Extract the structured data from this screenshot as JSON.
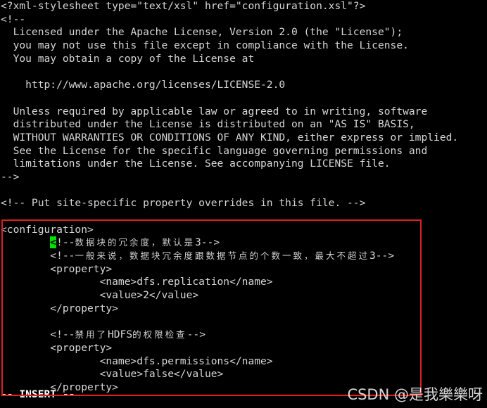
{
  "terminal": {
    "app": "vim",
    "mode_status": "-- INSERT --",
    "background_color": "#000000",
    "foreground_color": "#d4d4d4",
    "cursor_color": "#00e000",
    "cursor_char": "<",
    "lines": [
      {
        "id": "l01",
        "text": "<?xml-stylesheet type=\"text/xsl\" href=\"configuration.xsl\"?>"
      },
      {
        "id": "l02",
        "text": "<!--"
      },
      {
        "id": "l03",
        "text": "  Licensed under the Apache License, Version 2.0 (the \"License\");"
      },
      {
        "id": "l04",
        "text": "  you may not use this file except in compliance with the License."
      },
      {
        "id": "l05",
        "text": "  You may obtain a copy of the License at"
      },
      {
        "id": "l06",
        "text": ""
      },
      {
        "id": "l07",
        "text": "    http://www.apache.org/licenses/LICENSE-2.0"
      },
      {
        "id": "l08",
        "text": ""
      },
      {
        "id": "l09",
        "text": "  Unless required by applicable law or agreed to in writing, software"
      },
      {
        "id": "l10",
        "text": "  distributed under the License is distributed on an \"AS IS\" BASIS,"
      },
      {
        "id": "l11",
        "text": "  WITHOUT WARRANTIES OR CONDITIONS OF ANY KIND, either express or implied."
      },
      {
        "id": "l12",
        "text": "  See the License for the specific language governing permissions and"
      },
      {
        "id": "l13",
        "text": "  limitations under the License. See accompanying LICENSE file."
      },
      {
        "id": "l14",
        "text": "-->"
      },
      {
        "id": "l15",
        "text": ""
      },
      {
        "id": "l16",
        "text": "<!-- Put site-specific property overrides in this file. -->"
      },
      {
        "id": "l17",
        "text": ""
      },
      {
        "id": "l18",
        "text": "<configuration>"
      }
    ],
    "config_block": {
      "cursor_line": {
        "indent": "        ",
        "cursor_char": "<",
        "open": "!--",
        "comment_cjk": "数据块的冗余度，默认是",
        "value": "3",
        "close": "-->"
      },
      "comment_line_2": {
        "indent": "        ",
        "open": "<!--",
        "comment_cjk": "一般来说，数据块冗余度跟数据节点的个数一致，最大不超过",
        "value": "3",
        "close": "-->"
      },
      "property_1": {
        "open_tag": "        <property>",
        "name_line": "                <name>dfs.replication</name>",
        "value_line": "                <value>2</value>",
        "close_tag": "        </property>"
      },
      "comment_line_3": {
        "indent": "        ",
        "open": "<!--",
        "comment_cjk_a": "禁用了",
        "comment_ascii": "HDFS",
        "comment_cjk_b": "的权限检查",
        "close": "-->"
      },
      "property_2": {
        "open_tag": "        <property>",
        "name_line": "                <name>dfs.permissions</name>",
        "value_line": "                <value>false</value>",
        "close_tag": "        </property>"
      }
    }
  },
  "annotation": {
    "rect_color": "#e02020",
    "rect_label": "highlighted-configuration-block"
  },
  "watermark": {
    "text": "CSDN @是我樂樂呀"
  }
}
